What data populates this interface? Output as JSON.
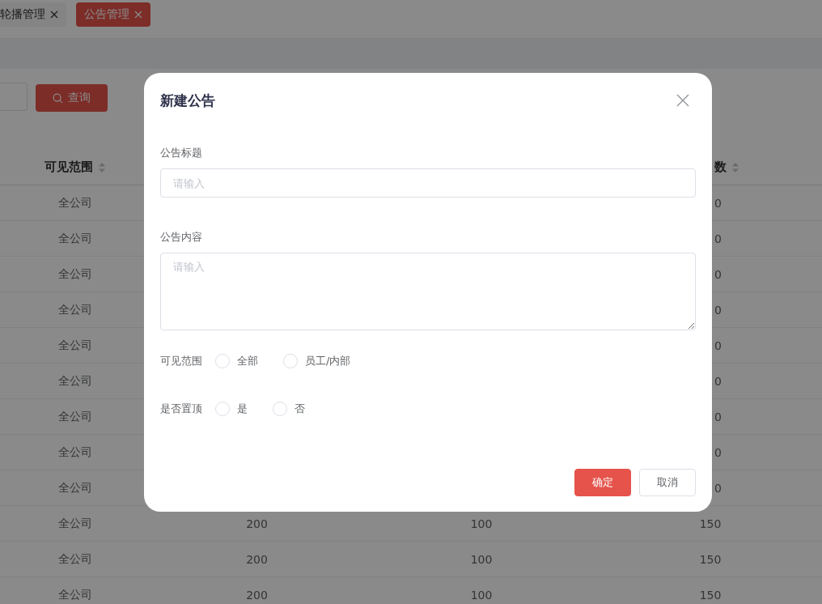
{
  "tabs": [
    {
      "label": "轮播管理",
      "selected": false
    },
    {
      "label": "公告管理",
      "selected": true
    }
  ],
  "search": {
    "button": "查询"
  },
  "table": {
    "header": {
      "column_1": "可见范围",
      "column_4": "数"
    },
    "rows": [
      {
        "column_1": "全公司",
        "column_4": "0"
      },
      {
        "column_1": "全公司",
        "column_4": "0"
      },
      {
        "column_1": "全公司",
        "column_4": "0"
      },
      {
        "column_1": "全公司",
        "column_4": "0"
      },
      {
        "column_1": "全公司",
        "column_4": "0"
      },
      {
        "column_1": "全公司",
        "column_4": "0"
      },
      {
        "column_1": "全公司",
        "column_4": "0"
      },
      {
        "column_1": "全公司",
        "column_4": "0"
      },
      {
        "column_1": "全公司",
        "column_4": "0"
      },
      {
        "column_1": "全公司",
        "column_2": "200",
        "column_3": "100",
        "column_4": "150"
      },
      {
        "column_1": "全公司",
        "column_2": "200",
        "column_3": "100",
        "column_4": "150"
      },
      {
        "column_1": "全公司",
        "column_2": "200",
        "column_3": "100",
        "column_4": "150"
      }
    ]
  },
  "dialog": {
    "title": "新建公告",
    "fields": [
      {
        "kind": "input",
        "label": "公告标题",
        "placeholder": "请输入"
      },
      {
        "kind": "textarea",
        "label": "公告内容",
        "placeholder": "请输入"
      }
    ],
    "radio_groups": [
      {
        "label": "可见范围",
        "options": [
          {
            "label": "全部",
            "selected": false
          },
          {
            "label": "员工/内部",
            "selected": false
          }
        ]
      },
      {
        "label": "是否置顶",
        "options": [
          {
            "label": "是",
            "selected": false
          },
          {
            "label": "否",
            "selected": false
          }
        ]
      }
    ],
    "buttons": [
      {
        "label": "确定",
        "kind": "primary"
      },
      {
        "label": "取消",
        "kind": "default"
      }
    ]
  }
}
